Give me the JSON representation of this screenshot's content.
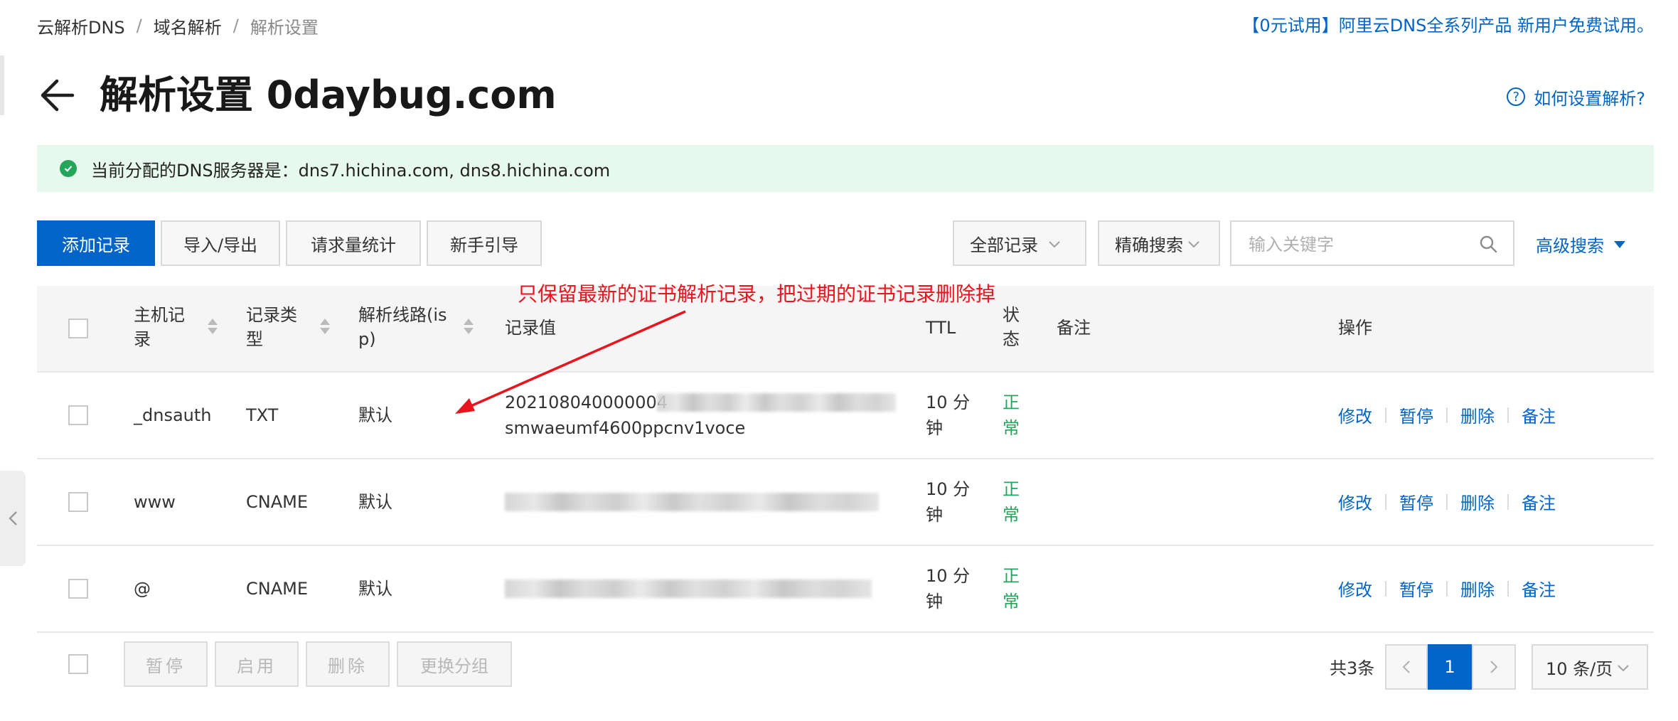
{
  "breadcrumb": {
    "items": [
      "云解析DNS",
      "域名解析",
      "解析设置"
    ],
    "separator": "/"
  },
  "promo_link": "【0元试用】阿里云DNS全系列产品 新用户免费试用。",
  "page": {
    "title": "解析设置 0daybug.com",
    "help_link": "如何设置解析?"
  },
  "notice": {
    "text": "当前分配的DNS服务器是：dns7.hichina.com, dns8.hichina.com",
    "icon": "check-circle-icon"
  },
  "toolbar": {
    "add_label": "添加记录",
    "import_export_label": "导入/导出",
    "stats_label": "请求量统计",
    "guide_label": "新手引导",
    "record_filter": "全部记录",
    "search_mode": "精确搜索",
    "search_placeholder": "输入关键字",
    "search_value": "",
    "advanced_search": "高级搜索"
  },
  "table": {
    "headers": {
      "host": "主机记录",
      "type": "记录类型",
      "line": "解析线路(isp)",
      "value": "记录值",
      "ttl": "TTL",
      "status": "状态",
      "remark": "备注",
      "actions": "操作"
    },
    "rows": [
      {
        "host": "_dnsauth",
        "type": "TXT",
        "line": "默认",
        "value_line1": "202108040000004",
        "value_line2": "smwaeumf4600ppcnv1voce",
        "ttl": "10 分钟",
        "status": "正常",
        "remark": ""
      },
      {
        "host": "www",
        "type": "CNAME",
        "line": "默认",
        "value_line1": "",
        "value_line2": "",
        "ttl": "10 分钟",
        "status": "正常",
        "remark": ""
      },
      {
        "host": "@",
        "type": "CNAME",
        "line": "默认",
        "value_line1": "",
        "value_line2": "",
        "ttl": "10 分钟",
        "status": "正常",
        "remark": ""
      }
    ],
    "row_actions": {
      "edit": "修改",
      "pause": "暂停",
      "delete": "删除",
      "remark": "备注"
    }
  },
  "bulk_actions": {
    "pause": "暂停",
    "enable": "启用",
    "delete": "删除",
    "change_group": "更换分组"
  },
  "pagination": {
    "total_text": "共3条",
    "current_page": "1",
    "page_size": "10 条/页"
  },
  "annotation": {
    "text": "只保留最新的证书解析记录，把过期的证书记录删除掉"
  },
  "colors": {
    "primary": "#0064c8",
    "success": "#23a55a",
    "notice_bg": "#e7f8ee",
    "annotation": "#e8141e"
  }
}
